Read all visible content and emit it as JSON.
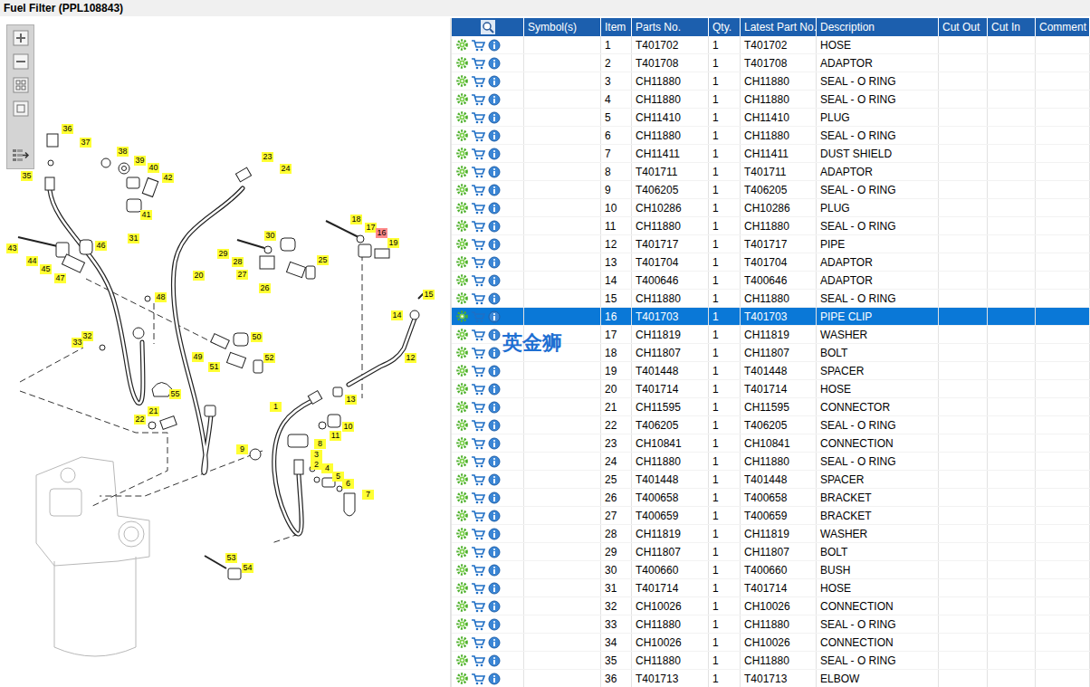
{
  "window": {
    "title": "Fuel Filter (PPL108843)"
  },
  "watermark": "英金狮",
  "diagram": {
    "callouts": [
      {
        "number": "36",
        "selected": false
      },
      {
        "number": "37",
        "selected": false
      },
      {
        "number": "35",
        "selected": false
      },
      {
        "number": "38",
        "selected": false
      },
      {
        "number": "39",
        "selected": false
      },
      {
        "number": "40",
        "selected": false
      },
      {
        "number": "42",
        "selected": false
      },
      {
        "number": "41",
        "selected": false
      },
      {
        "number": "23",
        "selected": false
      },
      {
        "number": "24",
        "selected": false
      },
      {
        "number": "18",
        "selected": false
      },
      {
        "number": "17",
        "selected": false
      },
      {
        "number": "16",
        "selected": true
      },
      {
        "number": "19",
        "selected": false
      },
      {
        "number": "30",
        "selected": false
      },
      {
        "number": "29",
        "selected": false
      },
      {
        "number": "28",
        "selected": false
      },
      {
        "number": "27",
        "selected": false
      },
      {
        "number": "26",
        "selected": false
      },
      {
        "number": "25",
        "selected": false
      },
      {
        "number": "43",
        "selected": false
      },
      {
        "number": "44",
        "selected": false
      },
      {
        "number": "45",
        "selected": false
      },
      {
        "number": "46",
        "selected": false
      },
      {
        "number": "47",
        "selected": false
      },
      {
        "number": "31",
        "selected": false
      },
      {
        "number": "20",
        "selected": false
      },
      {
        "number": "48",
        "selected": false
      },
      {
        "number": "15",
        "selected": false
      },
      {
        "number": "14",
        "selected": false
      },
      {
        "number": "12",
        "selected": false
      },
      {
        "number": "32",
        "selected": false
      },
      {
        "number": "33",
        "selected": false
      },
      {
        "number": "50",
        "selected": false
      },
      {
        "number": "49",
        "selected": false
      },
      {
        "number": "51",
        "selected": false
      },
      {
        "number": "52",
        "selected": false
      },
      {
        "number": "55",
        "selected": false
      },
      {
        "number": "13",
        "selected": false
      },
      {
        "number": "1",
        "selected": false
      },
      {
        "number": "21",
        "selected": false
      },
      {
        "number": "22",
        "selected": false
      },
      {
        "number": "10",
        "selected": false
      },
      {
        "number": "11",
        "selected": false
      },
      {
        "number": "8",
        "selected": false
      },
      {
        "number": "9",
        "selected": false
      },
      {
        "number": "3",
        "selected": false
      },
      {
        "number": "2",
        "selected": false
      },
      {
        "number": "4",
        "selected": false
      },
      {
        "number": "5",
        "selected": false
      },
      {
        "number": "6",
        "selected": false
      },
      {
        "number": "7",
        "selected": false
      },
      {
        "number": "53",
        "selected": false
      },
      {
        "number": "54",
        "selected": false
      }
    ]
  },
  "table": {
    "columns": [
      "Symbol(s)",
      "Item",
      "Parts No.",
      "Qty.",
      "Latest Part No.",
      "Description",
      "Cut Out",
      "Cut In",
      "Comment"
    ],
    "rows": [
      {
        "item": "1",
        "parts_no": "T401702",
        "qty": "1",
        "latest_part_no": "T401702",
        "description": "HOSE",
        "selected": false
      },
      {
        "item": "2",
        "parts_no": "T401708",
        "qty": "1",
        "latest_part_no": "T401708",
        "description": "ADAPTOR",
        "selected": false
      },
      {
        "item": "3",
        "parts_no": "CH11880",
        "qty": "1",
        "latest_part_no": "CH11880",
        "description": "SEAL - O RING",
        "selected": false
      },
      {
        "item": "4",
        "parts_no": "CH11880",
        "qty": "1",
        "latest_part_no": "CH11880",
        "description": "SEAL - O RING",
        "selected": false
      },
      {
        "item": "5",
        "parts_no": "CH11410",
        "qty": "1",
        "latest_part_no": "CH11410",
        "description": "PLUG",
        "selected": false
      },
      {
        "item": "6",
        "parts_no": "CH11880",
        "qty": "1",
        "latest_part_no": "CH11880",
        "description": "SEAL - O RING",
        "selected": false
      },
      {
        "item": "7",
        "parts_no": "CH11411",
        "qty": "1",
        "latest_part_no": "CH11411",
        "description": "DUST SHIELD",
        "selected": false
      },
      {
        "item": "8",
        "parts_no": "T401711",
        "qty": "1",
        "latest_part_no": "T401711",
        "description": "ADAPTOR",
        "selected": false
      },
      {
        "item": "9",
        "parts_no": "T406205",
        "qty": "1",
        "latest_part_no": "T406205",
        "description": "SEAL - O RING",
        "selected": false
      },
      {
        "item": "10",
        "parts_no": "CH10286",
        "qty": "1",
        "latest_part_no": "CH10286",
        "description": "PLUG",
        "selected": false
      },
      {
        "item": "11",
        "parts_no": "CH11880",
        "qty": "1",
        "latest_part_no": "CH11880",
        "description": "SEAL - O RING",
        "selected": false
      },
      {
        "item": "12",
        "parts_no": "T401717",
        "qty": "1",
        "latest_part_no": "T401717",
        "description": "PIPE",
        "selected": false
      },
      {
        "item": "13",
        "parts_no": "T401704",
        "qty": "1",
        "latest_part_no": "T401704",
        "description": "ADAPTOR",
        "selected": false
      },
      {
        "item": "14",
        "parts_no": "T400646",
        "qty": "1",
        "latest_part_no": "T400646",
        "description": "ADAPTOR",
        "selected": false
      },
      {
        "item": "15",
        "parts_no": "CH11880",
        "qty": "1",
        "latest_part_no": "CH11880",
        "description": "SEAL - O RING",
        "selected": false
      },
      {
        "item": "16",
        "parts_no": "T401703",
        "qty": "1",
        "latest_part_no": "T401703",
        "description": "PIPE CLIP",
        "selected": true
      },
      {
        "item": "17",
        "parts_no": "CH11819",
        "qty": "1",
        "latest_part_no": "CH11819",
        "description": "WASHER",
        "selected": false
      },
      {
        "item": "18",
        "parts_no": "CH11807",
        "qty": "1",
        "latest_part_no": "CH11807",
        "description": "BOLT",
        "selected": false
      },
      {
        "item": "19",
        "parts_no": "T401448",
        "qty": "1",
        "latest_part_no": "T401448",
        "description": "SPACER",
        "selected": false
      },
      {
        "item": "20",
        "parts_no": "T401714",
        "qty": "1",
        "latest_part_no": "T401714",
        "description": "HOSE",
        "selected": false
      },
      {
        "item": "21",
        "parts_no": "CH11595",
        "qty": "1",
        "latest_part_no": "CH11595",
        "description": "CONNECTOR",
        "selected": false
      },
      {
        "item": "22",
        "parts_no": "T406205",
        "qty": "1",
        "latest_part_no": "T406205",
        "description": "SEAL - O RING",
        "selected": false
      },
      {
        "item": "23",
        "parts_no": "CH10841",
        "qty": "1",
        "latest_part_no": "CH10841",
        "description": "CONNECTION",
        "selected": false
      },
      {
        "item": "24",
        "parts_no": "CH11880",
        "qty": "1",
        "latest_part_no": "CH11880",
        "description": "SEAL - O RING",
        "selected": false
      },
      {
        "item": "25",
        "parts_no": "T401448",
        "qty": "1",
        "latest_part_no": "T401448",
        "description": "SPACER",
        "selected": false
      },
      {
        "item": "26",
        "parts_no": "T400658",
        "qty": "1",
        "latest_part_no": "T400658",
        "description": "BRACKET",
        "selected": false
      },
      {
        "item": "27",
        "parts_no": "T400659",
        "qty": "1",
        "latest_part_no": "T400659",
        "description": "BRACKET",
        "selected": false
      },
      {
        "item": "28",
        "parts_no": "CH11819",
        "qty": "1",
        "latest_part_no": "CH11819",
        "description": "WASHER",
        "selected": false
      },
      {
        "item": "29",
        "parts_no": "CH11807",
        "qty": "1",
        "latest_part_no": "CH11807",
        "description": "BOLT",
        "selected": false
      },
      {
        "item": "30",
        "parts_no": "T400660",
        "qty": "1",
        "latest_part_no": "T400660",
        "description": "BUSH",
        "selected": false
      },
      {
        "item": "31",
        "parts_no": "T401714",
        "qty": "1",
        "latest_part_no": "T401714",
        "description": "HOSE",
        "selected": false
      },
      {
        "item": "32",
        "parts_no": "CH10026",
        "qty": "1",
        "latest_part_no": "CH10026",
        "description": "CONNECTION",
        "selected": false
      },
      {
        "item": "33",
        "parts_no": "CH11880",
        "qty": "1",
        "latest_part_no": "CH11880",
        "description": "SEAL - O RING",
        "selected": false
      },
      {
        "item": "34",
        "parts_no": "CH10026",
        "qty": "1",
        "latest_part_no": "CH10026",
        "description": "CONNECTION",
        "selected": false
      },
      {
        "item": "35",
        "parts_no": "CH11880",
        "qty": "1",
        "latest_part_no": "CH11880",
        "description": "SEAL - O RING",
        "selected": false
      },
      {
        "item": "36",
        "parts_no": "T401713",
        "qty": "1",
        "latest_part_no": "T401713",
        "description": "ELBOW",
        "selected": false
      }
    ]
  }
}
